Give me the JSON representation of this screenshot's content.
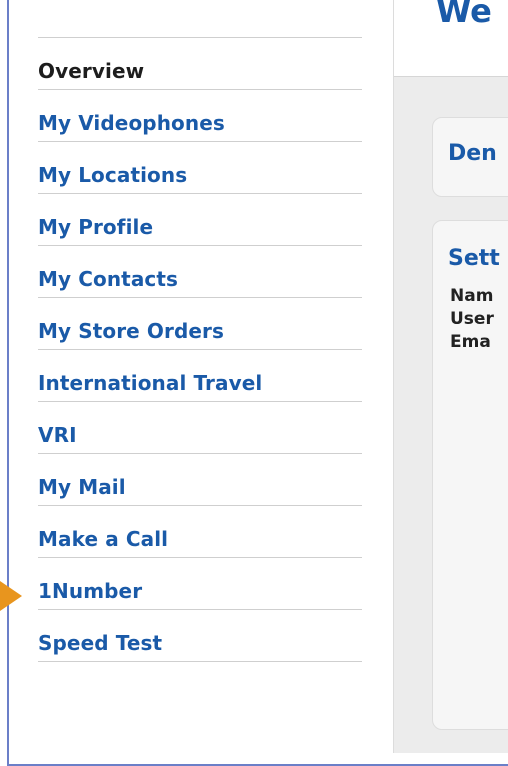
{
  "sidebar": {
    "items": [
      {
        "label": "Overview",
        "active": true
      },
      {
        "label": "My Videophones"
      },
      {
        "label": "My Locations"
      },
      {
        "label": "My Profile"
      },
      {
        "label": "My Contacts"
      },
      {
        "label": "My Store Orders"
      },
      {
        "label": "International Travel"
      },
      {
        "label": "VRI"
      },
      {
        "label": "My Mail"
      },
      {
        "label": "Make a Call"
      },
      {
        "label": "1Number"
      },
      {
        "label": "Speed Test"
      }
    ]
  },
  "main": {
    "title": "We",
    "card1_title": "Den",
    "card2_title": "Sett",
    "fields": [
      "Nam",
      "User",
      "Ema"
    ]
  },
  "colors": {
    "link": "#1a5aa8",
    "active": "#1d1d1d",
    "frame": "#6b7fc8",
    "arrow": "#e8951e"
  },
  "icons": {
    "pointer": "arrow-right-icon"
  }
}
